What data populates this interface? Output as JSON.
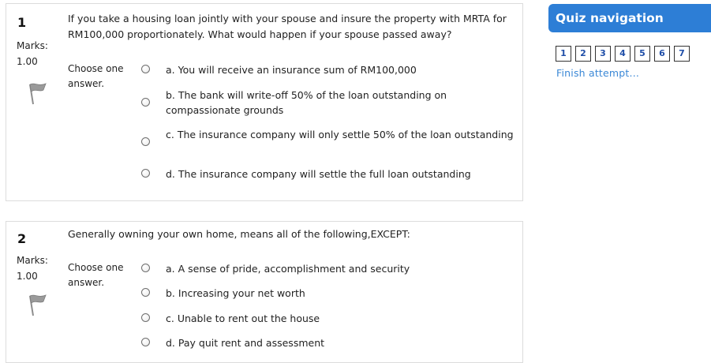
{
  "questions": [
    {
      "number": "1",
      "marks_label": "Marks:",
      "marks_value": "1.00",
      "text": "If you take a housing loan jointly with your spouse and insure the property with MRTA for RM100,000 proportionately. What would happen if your spouse passed away?",
      "prompt": "Choose one answer.",
      "options": [
        "a. You will receive an insurance sum of RM100,000",
        "b. The bank will write-off 50% of the loan outstanding on compassionate grounds",
        "c. The insurance company will only settle 50% of the loan outstanding",
        "d. The insurance company will settle the full loan outstanding"
      ]
    },
    {
      "number": "2",
      "marks_label": "Marks:",
      "marks_value": "1.00",
      "text": "Generally owning your own home, means all of the following,EXCEPT:",
      "prompt": "Choose one answer.",
      "options": [
        "a. A sense of pride, accomplishment and security",
        "b. Increasing your net worth",
        "c. Unable to rent out the house",
        "d. Pay quit rent and assessment"
      ]
    }
  ],
  "quiz_navigation": {
    "title": "Quiz navigation",
    "pages": [
      "1",
      "2",
      "3",
      "4",
      "5",
      "6",
      "7"
    ],
    "finish_label": "Finish attempt..."
  },
  "colors": {
    "nav_header_bg": "#2d7ed6",
    "link": "#3b88d6",
    "page_number": "#1f4ea8",
    "box_border": "#dcdcdc"
  },
  "icons": {
    "flag": "flag-icon",
    "radio": "radio-button"
  }
}
